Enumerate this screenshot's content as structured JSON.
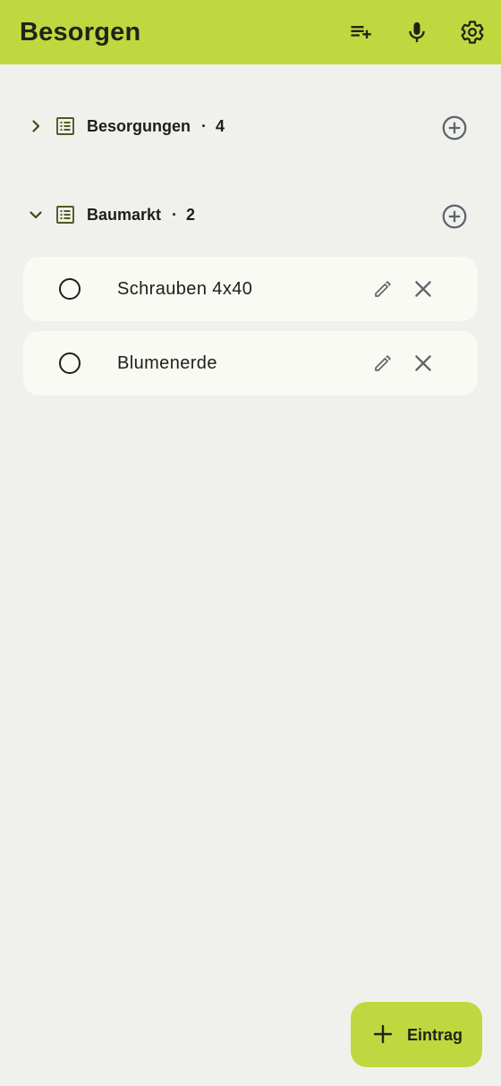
{
  "appbar": {
    "title": "Besorgen",
    "actions": [
      {
        "name": "add-list",
        "icon": "playlist-add-icon"
      },
      {
        "name": "voice-input",
        "icon": "microphone-icon"
      },
      {
        "name": "settings",
        "icon": "gear-icon"
      }
    ],
    "color": "#bfd83f"
  },
  "lists": [
    {
      "name": "Besorgungen",
      "count": "4",
      "expanded": false,
      "chevron_icon": "chevron-right-icon",
      "items": []
    },
    {
      "name": "Baumarkt",
      "count": "2",
      "expanded": true,
      "chevron_icon": "chevron-down-icon",
      "items": [
        {
          "text": "Schrauben 4x40",
          "checked": false
        },
        {
          "text": "Blumenerde",
          "checked": false
        }
      ]
    }
  ],
  "separator": "·",
  "fab": {
    "label": "Eintrag",
    "icon": "plus-icon"
  }
}
